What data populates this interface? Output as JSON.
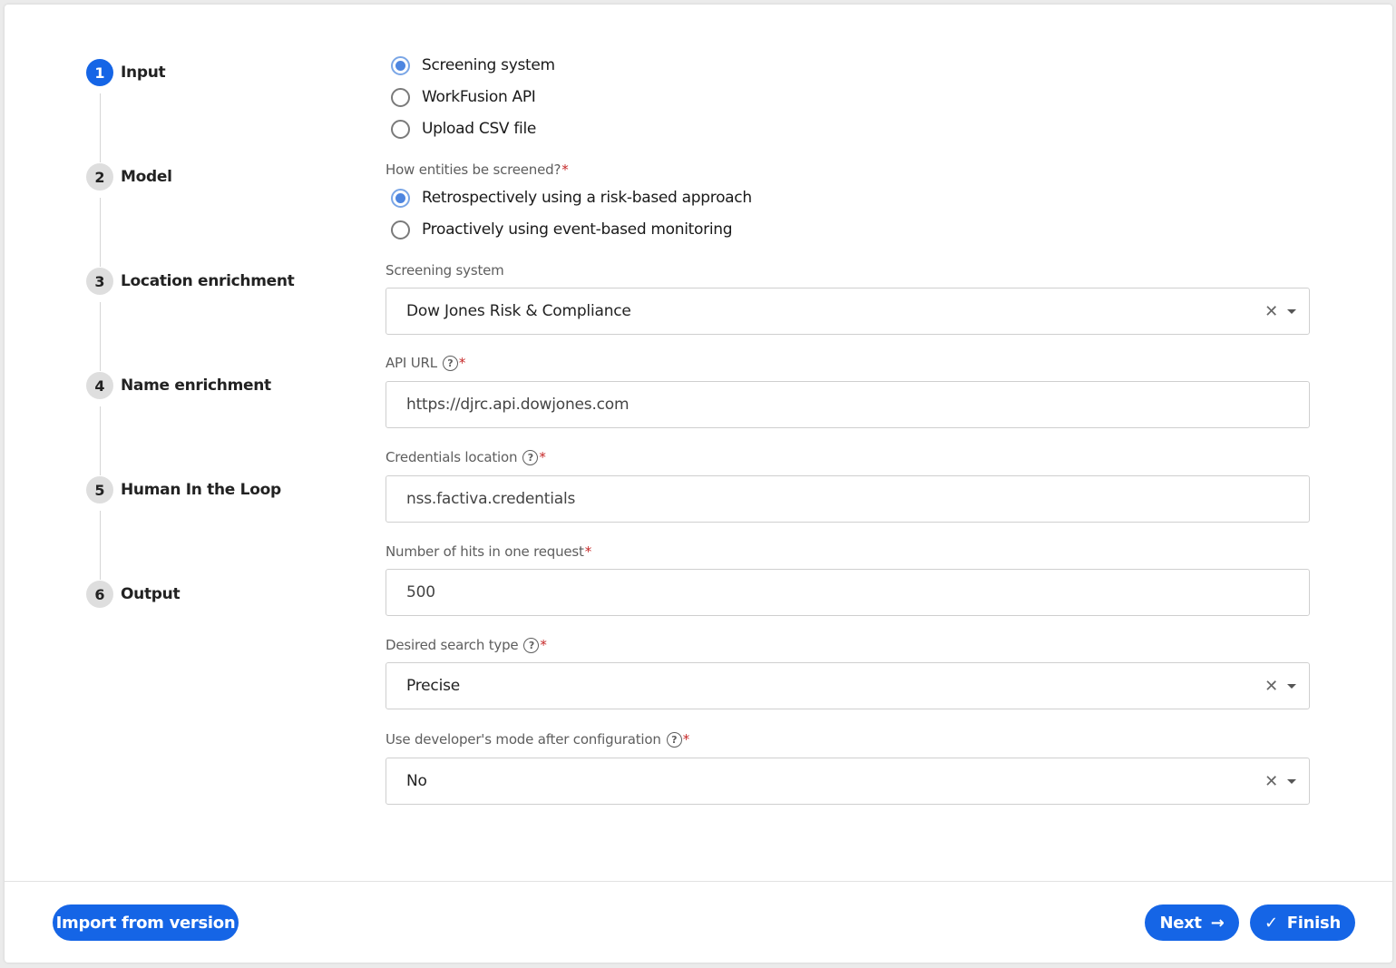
{
  "stepper": {
    "steps": [
      {
        "num": "1",
        "label": "Input"
      },
      {
        "num": "2",
        "label": "Model"
      },
      {
        "num": "3",
        "label": "Location enrichment"
      },
      {
        "num": "4",
        "label": "Name enrichment"
      },
      {
        "num": "5",
        "label": "Human In the Loop"
      },
      {
        "num": "6",
        "label": "Output"
      }
    ],
    "active_index": 0
  },
  "input_source": {
    "options": [
      "Screening system",
      "WorkFusion API",
      "Upload CSV file"
    ],
    "selected": "Screening system"
  },
  "screening_mode": {
    "label": "How entities be screened?",
    "required_mark": "*",
    "options": [
      "Retrospectively using a risk-based approach",
      "Proactively using event-based monitoring"
    ],
    "selected": "Retrospectively using a risk-based approach"
  },
  "screening_system": {
    "label": "Screening system",
    "value": "Dow Jones Risk & Compliance"
  },
  "api_url": {
    "label": "API URL",
    "required_mark": "*",
    "value": "https://djrc.api.dowjones.com"
  },
  "credentials_location": {
    "label": "Credentials location",
    "required_mark": "*",
    "value": "nss.factiva.credentials"
  },
  "hits_per_request": {
    "label": "Number of hits in one request",
    "required_mark": "*",
    "value": "500"
  },
  "search_type": {
    "label": "Desired search type",
    "required_mark": "*",
    "value": "Precise"
  },
  "developer_mode": {
    "label": "Use developer's mode after configuration",
    "required_mark": "*",
    "value": "No"
  },
  "icons": {
    "help": "help-circle-icon",
    "clear": "close-icon",
    "caret": "caret-down-icon",
    "next_arrow": "arrow-right-icon",
    "finish_check": "check-icon"
  },
  "footer": {
    "import_label": "Import from version",
    "next_label": "Next",
    "finish_label": "Finish"
  },
  "colors": {
    "accent": "#1565e6",
    "required": "#c62828"
  }
}
